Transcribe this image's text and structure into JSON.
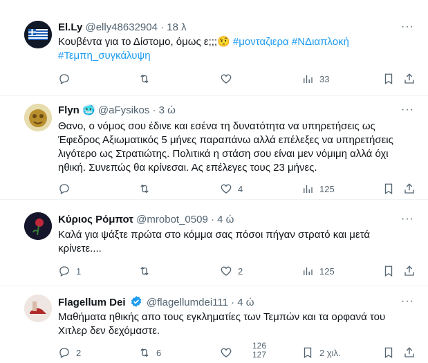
{
  "tweets": [
    {
      "name": "El.Ly",
      "handle": "@elly48632904",
      "time": "18 λ",
      "text_plain": "Κουβέντα για το Δίστομο, όμως ε;;;🤨 ",
      "hashtags": [
        "#μονταζιερα",
        "#ΝΔιαπλοκή",
        "#Τεμπη_συγκάλυψη"
      ],
      "replies": "",
      "retweets": "",
      "likes": "",
      "views": "33"
    },
    {
      "name": "Flyn",
      "handle": "@aFysikos",
      "time": "3 ώ",
      "name_emoji": "🥶",
      "text": "Θανο, ο νόμος σου έδινε και εσένα τη δυνατότητα να υπηρετήσεις ως Έφεδρος Αξιωματικός 5 μήνες παραπάνω αλλά επέλεξες να υπηρετήσεις λιγότερο ως Στρατιώτης. Πολιτικά η στάση σου είναι μεν νόμιμη αλλά όχι ηθική. Συνεπώς θα κρίνεσαι. Ας επέλεγες τους 23 μήνες.",
      "replies": "",
      "retweets": "",
      "likes": "4",
      "views": "125"
    },
    {
      "name": "Κύριος Ρόμποτ",
      "handle": "@mrobot_0509",
      "time": "4 ώ",
      "text": "Καλά για ψάξτε πρώτα στο κόμμα σας πόσοι πήγαν στρατό και μετά κρίνετε....",
      "replies": "1",
      "retweets": "",
      "likes": "2",
      "views": "125"
    },
    {
      "name": "Flagellum Dei",
      "handle": "@flagellumdei111",
      "time": "4 ώ",
      "text": "Μαθήματα ηθικής απο τους εγκληματίες των Τεμπών και τα ορφανά του Χιτλερ δεν δεχόμαστε.",
      "replies": "2",
      "retweets": "6",
      "likes": "",
      "views_stack": [
        "126",
        "127"
      ],
      "bookmarks": "2 χιλ."
    }
  ],
  "more_label": "···",
  "dot": "·",
  "colors": {
    "link": "#1d9bf0",
    "muted": "#536471",
    "verified": "#1d9bf0"
  },
  "icons": [
    "reply-icon",
    "retweet-icon",
    "like-icon",
    "views-icon",
    "bookmark-icon",
    "share-icon",
    "more-icon",
    "verified-icon"
  ]
}
